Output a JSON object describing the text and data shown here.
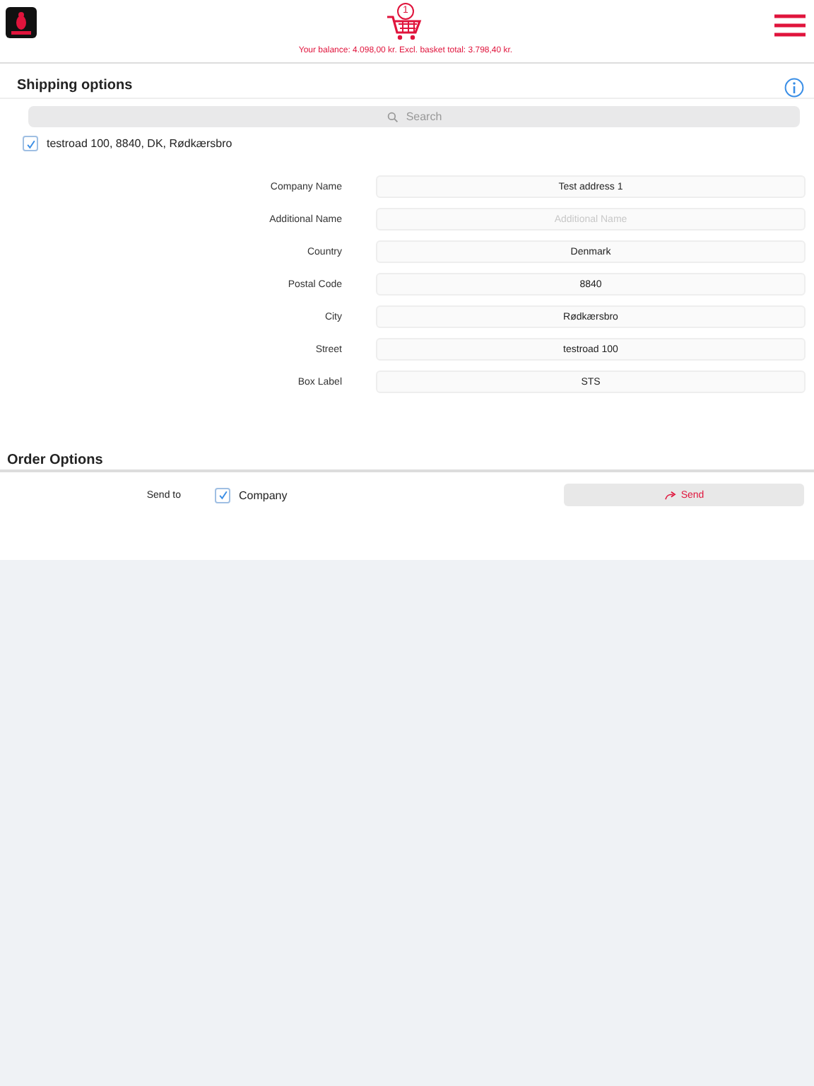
{
  "header": {
    "cart_count": "1",
    "balance": "Your balance: 4.098,00 kr. Excl. basket total: 3.798,40 kr."
  },
  "shipping": {
    "title": "Shipping options",
    "search": {
      "placeholder": "Search"
    },
    "addresses": [
      {
        "label": "testroad 100, 8840, DK, Rødkærsbro",
        "checked": true
      }
    ],
    "fields": [
      {
        "label": "Company Name",
        "value": "Test address 1"
      },
      {
        "label": "Additional Name",
        "placeholder": "Additional Name"
      },
      {
        "label": "Country",
        "value": "Denmark"
      },
      {
        "label": "Postal Code",
        "value": "8840"
      },
      {
        "label": "City",
        "value": "Rødkærsbro"
      },
      {
        "label": "Street",
        "value": "testroad 100"
      },
      {
        "label": "Box Label",
        "value": "STS"
      }
    ]
  },
  "order": {
    "title": "Order Options",
    "send_to_label": "Send to",
    "option": {
      "label": "Company",
      "checked": true
    },
    "send_button": "Send"
  }
}
